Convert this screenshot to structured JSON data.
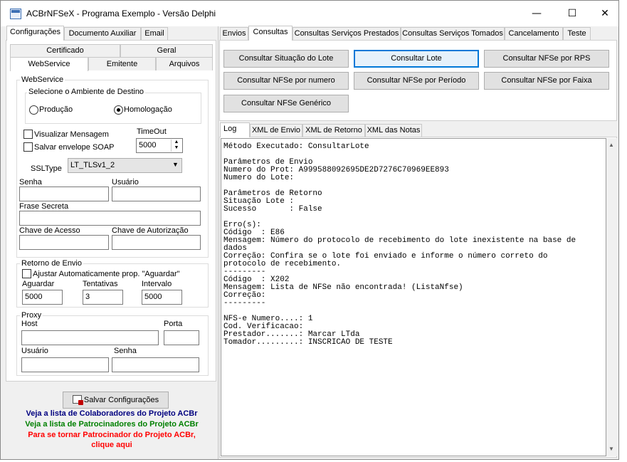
{
  "window": {
    "title": "ACBrNFSeX - Programa Exemplo - Versão Delphi",
    "minimize_glyph": "—",
    "maximize_glyph": "☐",
    "close_glyph": "✕"
  },
  "left": {
    "tabs": [
      "Configurações",
      "Documento Auxiliar",
      "Email"
    ],
    "subtabs_row1": [
      "Certificado",
      "Geral"
    ],
    "subtabs_row2": [
      "WebService",
      "Emitente",
      "Arquivos"
    ],
    "webservice": {
      "group_title": "WebService",
      "ambiente_title": "Selecione o Ambiente de Destino",
      "radio_producao": "Produção",
      "radio_homologacao": "Homologação",
      "selected_ambiente": "Homologação",
      "chk_visualizar": "Visualizar Mensagem",
      "chk_salvar": "Salvar envelope SOAP",
      "timeout_label": "TimeOut",
      "timeout_value": "5000",
      "ssltype_label": "SSLType",
      "ssltype_value": "LT_TLSv1_2",
      "senha_label": "Senha",
      "usuario_label": "Usuário",
      "frase_label": "Frase Secreta",
      "chave_acesso_label": "Chave de Acesso",
      "chave_autorizacao_label": "Chave de Autorização"
    },
    "retorno": {
      "title": "Retorno de Envio",
      "chk_ajustar": "Ajustar Automaticamente prop. \"Aguardar\"",
      "aguardar_label": "Aguardar",
      "aguardar_value": "5000",
      "tentativas_label": "Tentativas",
      "tentativas_value": "3",
      "intervalo_label": "Intervalo",
      "intervalo_value": "5000"
    },
    "proxy": {
      "title": "Proxy",
      "host_label": "Host",
      "porta_label": "Porta",
      "usuario_label": "Usuário",
      "senha_label": "Senha"
    },
    "save_button": "Salvar Configurações",
    "links": {
      "colaboradores": "Veja a lista de Colaboradores do Projeto ACBr",
      "patrocinadores": "Veja a lista de Patrocinadores do Projeto ACBr",
      "tornar1": "Para se tornar Patrocinador do Projeto ACBr,",
      "tornar2": "clique aqui"
    },
    "colors": {
      "navy": "#000080",
      "green": "#008000",
      "red": "#ff0000"
    }
  },
  "right": {
    "tabs": [
      "Envios",
      "Consultas",
      "Consultas Serviços Prestados",
      "Consultas Serviços Tomados",
      "Cancelamento",
      "Teste"
    ],
    "buttons": [
      "Consultar Situação do Lote",
      "Consultar Lote",
      "Consultar NFSe por RPS",
      "Consultar NFSe por numero",
      "Consultar NFSe por Período",
      "Consultar NFSe por Faixa",
      "Consultar NFSe Genérico"
    ],
    "log_tabs": [
      "Log",
      "XML de Envio",
      "XML de Retorno",
      "XML das Notas"
    ],
    "log_lines": [
      "Método Executado: ConsultarLote",
      "",
      "Parâmetros de Envio",
      "Numero do Prot: A999588092695DE2D7276C70969EE893",
      "Numero do Lote:",
      "",
      "Parâmetros de Retorno",
      "Situação Lote :",
      "Sucesso       : False",
      "",
      "Erro(s):",
      "Código  : E86",
      "Mensagem: Número do protocolo de recebimento do lote inexistente na base de",
      "dados",
      "Correção: Confira se o lote foi enviado e informe o número correto do",
      "protocolo de recebimento.",
      "---------",
      "Código  : X202",
      "Mensagem: Lista de NFSe não encontrada! (ListaNfse)",
      "Correção:",
      "---------",
      "",
      "NFS-e Numero....: 1",
      "Cod. Verificacao:",
      "Prestador.......: Marcar LTda",
      "Tomador.........: INSCRICAO DE TESTE"
    ]
  }
}
